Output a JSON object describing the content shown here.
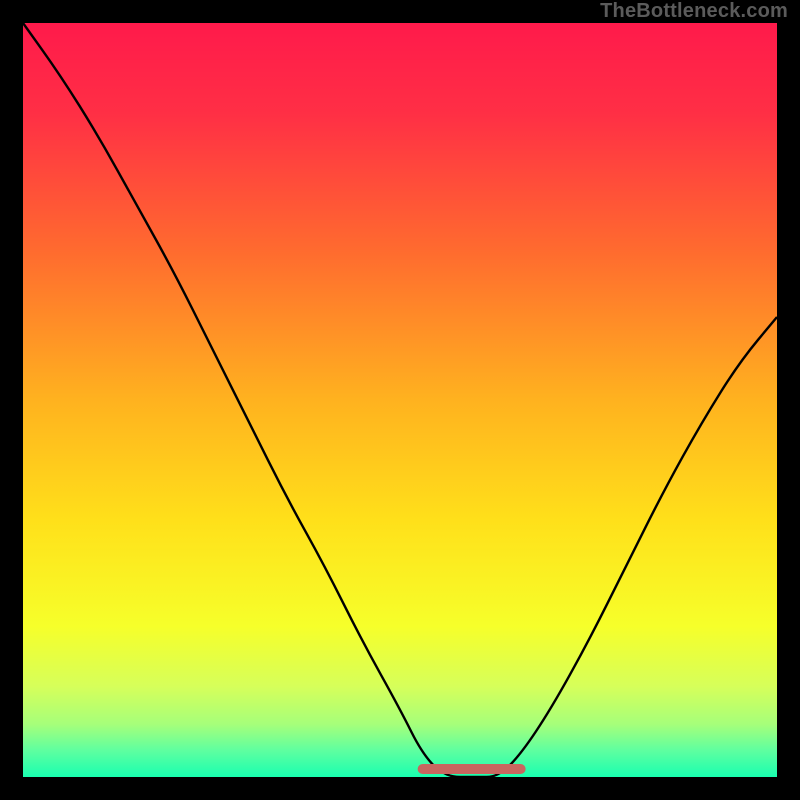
{
  "watermark": "TheBottleneck.com",
  "colors": {
    "frame": "#000000",
    "curve": "#000000",
    "flat_marker": "#c8665f",
    "gradient_stops": [
      {
        "offset": 0.0,
        "color": "#ff1a4b"
      },
      {
        "offset": 0.12,
        "color": "#ff2f45"
      },
      {
        "offset": 0.3,
        "color": "#ff6a2f"
      },
      {
        "offset": 0.5,
        "color": "#ffb21f"
      },
      {
        "offset": 0.66,
        "color": "#ffe01a"
      },
      {
        "offset": 0.8,
        "color": "#f6ff2a"
      },
      {
        "offset": 0.88,
        "color": "#d6ff5a"
      },
      {
        "offset": 0.93,
        "color": "#a6ff7a"
      },
      {
        "offset": 0.965,
        "color": "#5effa0"
      },
      {
        "offset": 1.0,
        "color": "#19ffb0"
      }
    ]
  },
  "chart_data": {
    "type": "line",
    "title": "",
    "xlabel": "",
    "ylabel": "",
    "xlim": [
      0,
      100
    ],
    "ylim": [
      0,
      100
    ],
    "series": [
      {
        "name": "bottleneck-curve",
        "x": [
          0,
          5,
          10,
          15,
          20,
          25,
          30,
          35,
          40,
          45,
          50,
          53,
          56,
          60,
          63,
          66,
          70,
          75,
          80,
          85,
          90,
          95,
          100
        ],
        "y": [
          100,
          93,
          85,
          76,
          67,
          57,
          47,
          37,
          28,
          18,
          9,
          3,
          0,
          0,
          0,
          3,
          9,
          18,
          28,
          38,
          47,
          55,
          61
        ]
      },
      {
        "name": "optimal-flat-region",
        "x": [
          53,
          66
        ],
        "y": [
          0,
          0
        ]
      }
    ],
    "annotations": [
      {
        "text": "TheBottleneck.com",
        "role": "watermark",
        "position": "top-right"
      }
    ]
  }
}
